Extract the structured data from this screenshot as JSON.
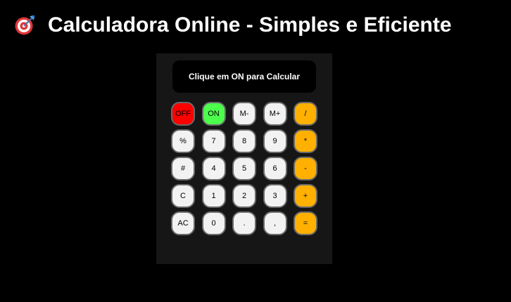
{
  "header": {
    "icon": "dart-target-icon",
    "title": "Calculadora Online - Simples e Eficiente"
  },
  "display": {
    "text": "Clique em ON para Calcular"
  },
  "keys": {
    "off": "OFF",
    "on": "ON",
    "m_minus": "M-",
    "m_plus": "M+",
    "divide": "/",
    "percent": "%",
    "seven": "7",
    "eight": "8",
    "nine": "9",
    "multiply": "*",
    "hash": "#",
    "four": "4",
    "five": "5",
    "six": "6",
    "subtract": "-",
    "clear": "C",
    "one": "1",
    "two": "2",
    "three": "3",
    "add": "+",
    "all_clear": "AC",
    "zero": "0",
    "dot": ".",
    "comma": ",",
    "equals": "="
  },
  "colors": {
    "background": "#000000",
    "calculator_body": "#161616",
    "off_key": "#ff0000",
    "on_key": "#4dff4d",
    "operator_key": "#ffb000",
    "default_key": "#f2f2f2"
  }
}
